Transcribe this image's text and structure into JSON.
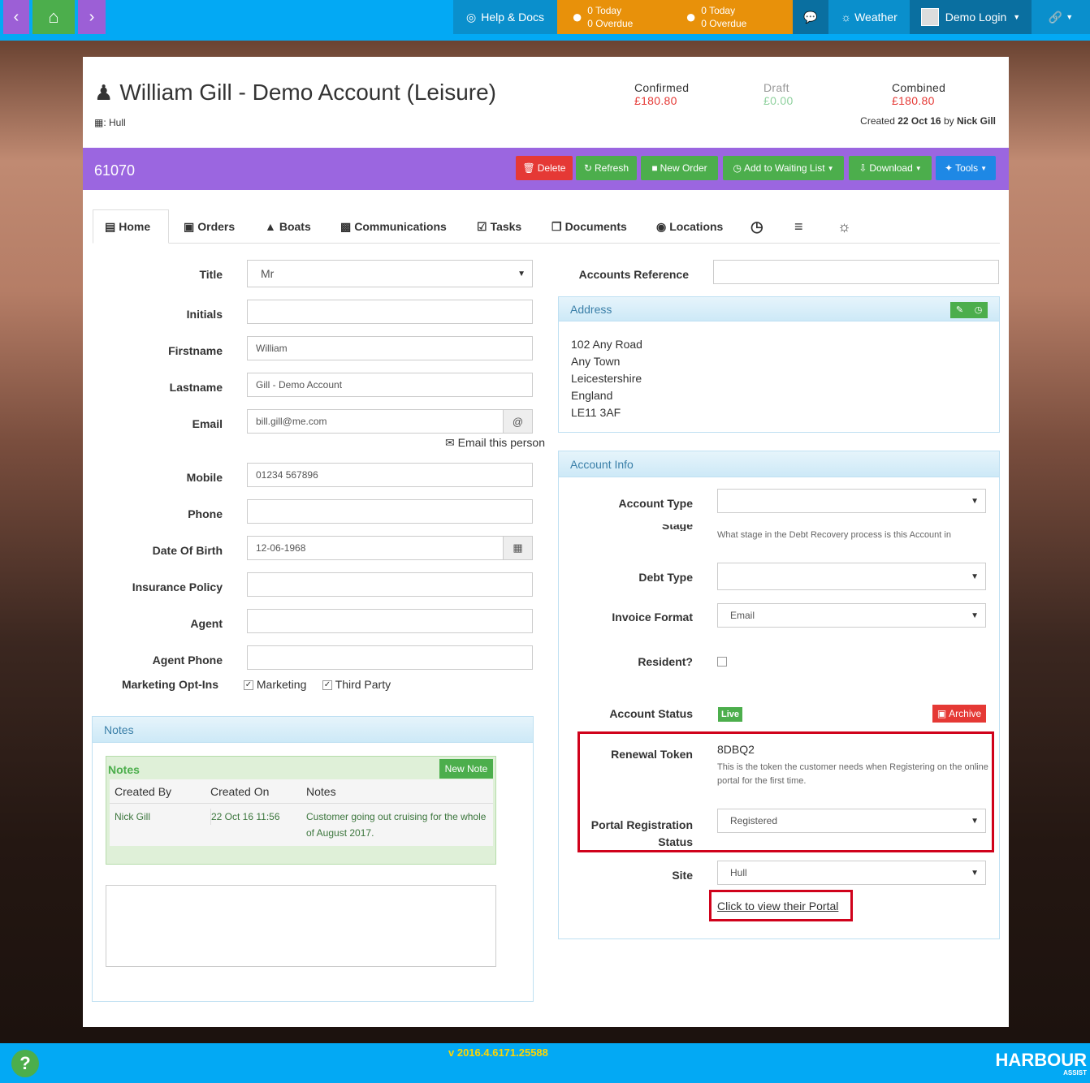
{
  "topnav": {
    "help": "Help & Docs",
    "tasks1": {
      "today": "0 Today",
      "overdue": "0 Overdue"
    },
    "tasks2": {
      "today": "0 Today",
      "overdue": "0 Overdue"
    },
    "weather": "Weather",
    "user": "Demo Login"
  },
  "header": {
    "title": "William Gill - Demo Account (Leisure)",
    "location": ": Hull",
    "confirmed_label": "Confirmed",
    "confirmed_value": "£180.80",
    "draft_label": "Draft",
    "draft_value": "£0.00",
    "combined_label": "Combined",
    "combined_value": "£180.80",
    "created_prefix": "Created",
    "created_date": "22 Oct 16",
    "created_by_prefix": "by",
    "created_by": "Nick Gill",
    "colors": {
      "confirmed": "#e53935",
      "draft": "#8fd19e"
    }
  },
  "toolbar": {
    "account_number": "61070",
    "delete": "Delete",
    "refresh": "Refresh",
    "new_order": "New Order",
    "waiting": "Add to Waiting List",
    "download": "Download",
    "tools": "Tools"
  },
  "tabs": [
    "Home",
    "Orders",
    "Boats",
    "Communications",
    "Tasks",
    "Documents",
    "Locations"
  ],
  "form": {
    "title_label": "Title",
    "title_value": "Mr",
    "initials_label": "Initials",
    "initials_value": "",
    "firstname_label": "Firstname",
    "firstname_value": "William",
    "lastname_label": "Lastname",
    "lastname_value": "Gill - Demo Account",
    "email_label": "Email",
    "email_value": "bill.gill@me.com",
    "email_link": "Email this person",
    "mobile_label": "Mobile",
    "mobile_value": "01234 567896",
    "phone_label": "Phone",
    "phone_value": "",
    "dob_label": "Date Of Birth",
    "dob_value": "12-06-1968",
    "insurance_label": "Insurance Policy",
    "insurance_value": "",
    "agent_label": "Agent",
    "agent_value": "",
    "agent_phone_label": "Agent Phone",
    "agent_phone_value": "",
    "marketing_label": "Marketing Opt-Ins",
    "marketing_opt": "Marketing",
    "third_party_opt": "Third Party"
  },
  "notes": {
    "panel_title": "Notes",
    "inner_title": "Notes",
    "new_note": "New Note",
    "columns": [
      "Created By",
      "Created On",
      "Notes"
    ],
    "rows": [
      {
        "by": "Nick Gill",
        "on": "22 Oct 16 11:56",
        "note": "Customer going out cruising for the whole of August 2017."
      }
    ]
  },
  "right": {
    "accounts_ref_label": "Accounts Reference",
    "address_title": "Address",
    "address_lines": [
      "102 Any Road",
      "Any Town",
      "Leicestershire",
      "England",
      "LE11 3AF"
    ],
    "account_info_title": "Account Info",
    "account_type_label": "Account Type",
    "stage_label": "Stage",
    "stage_help": "What stage in the Debt Recovery process is this Account in",
    "debt_type_label": "Debt Type",
    "invoice_format_label": "Invoice Format",
    "invoice_format_value": "Email",
    "resident_label": "Resident?",
    "account_status_label": "Account Status",
    "status_badge": "Live",
    "archive": "Archive",
    "renewal_token_label": "Renewal Token",
    "renewal_token_value": "8DBQ2",
    "renewal_help": "This is the token the customer needs when Registering on the online portal for the first time.",
    "portal_label_1": "Portal Registration",
    "portal_label_2": "Status",
    "portal_value": "Registered",
    "site_label": "Site",
    "site_value": "Hull",
    "portal_link": "Click to view their Portal"
  },
  "footer": {
    "version": "v 2016.4.6171.25588",
    "brand": "HARBOUR",
    "brand_sub": "ASSIST"
  }
}
